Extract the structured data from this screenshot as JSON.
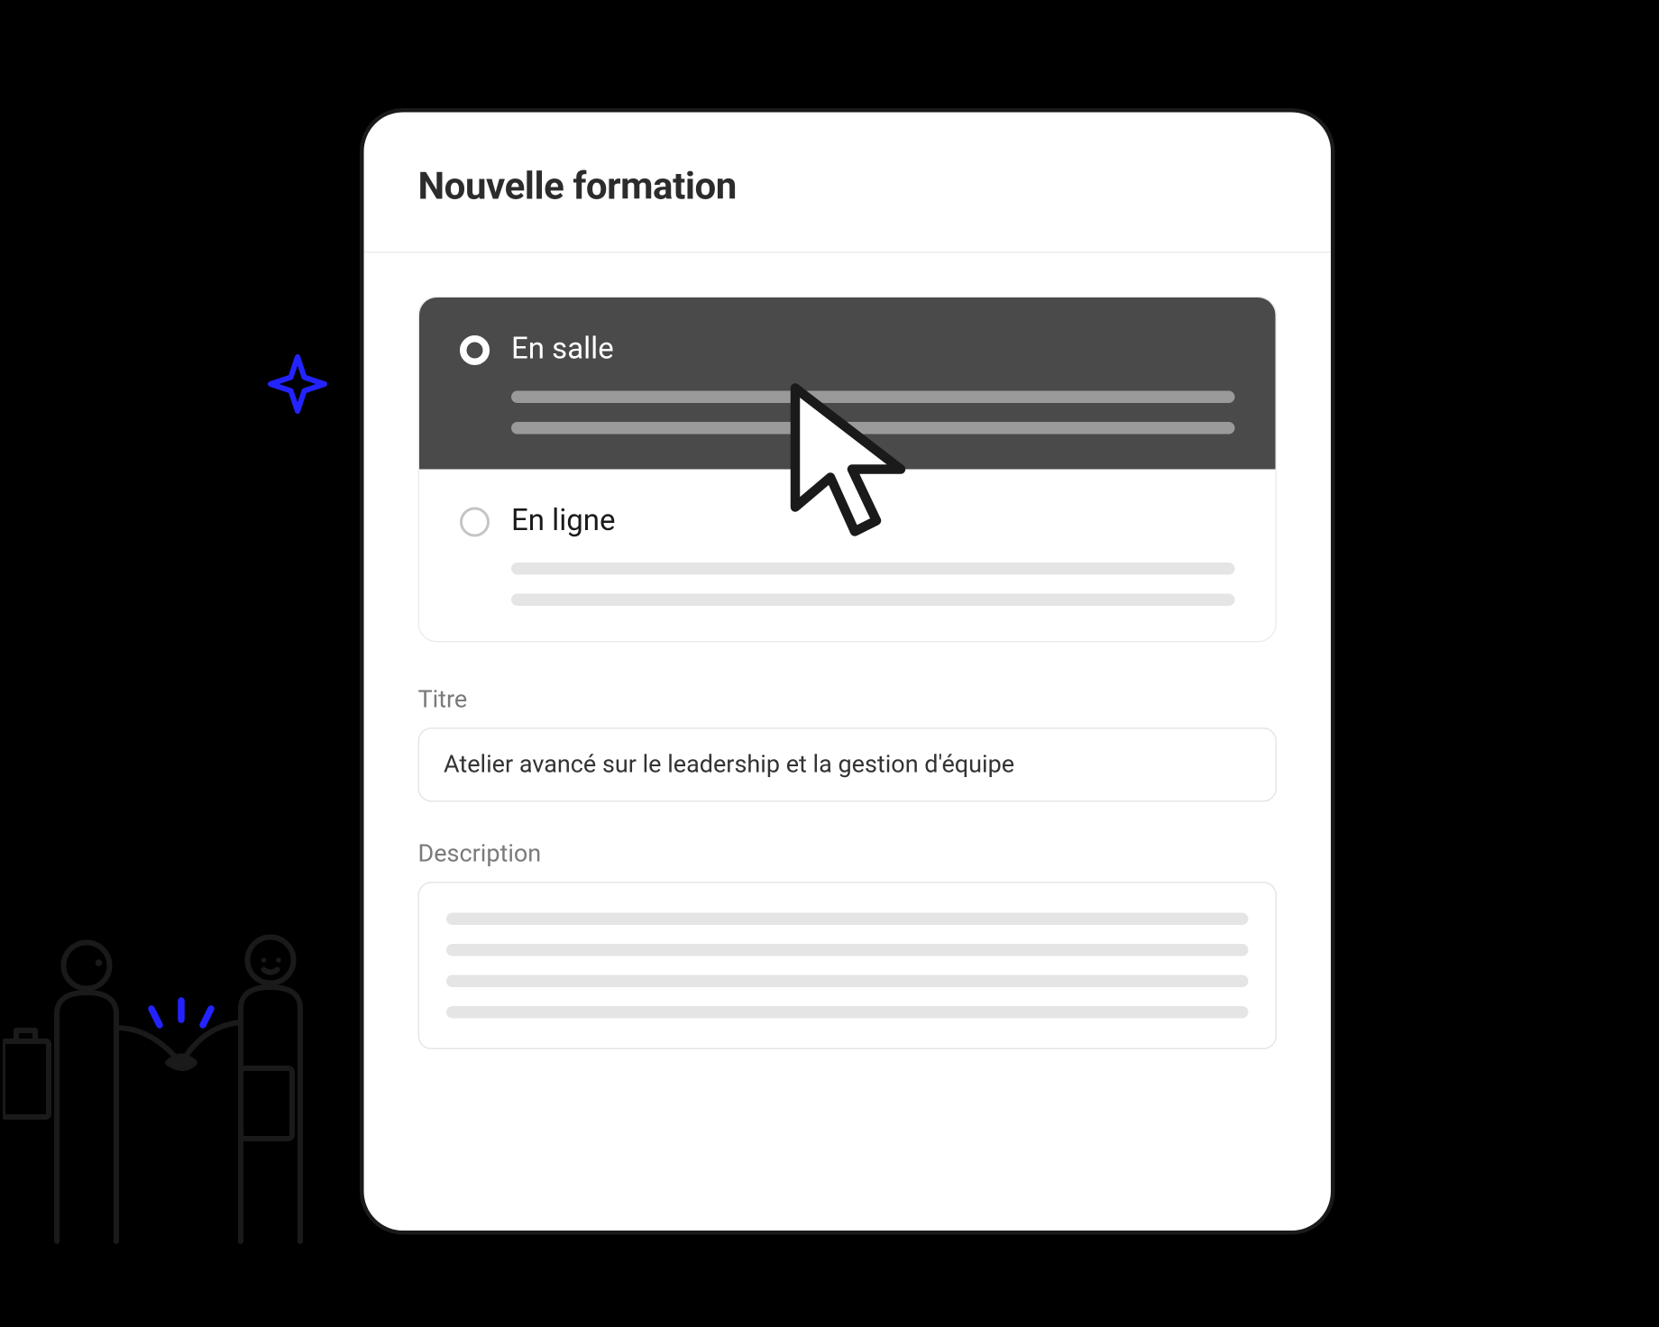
{
  "form": {
    "title": "Nouvelle formation",
    "type_options": [
      {
        "label": "En salle",
        "selected": true
      },
      {
        "label": "En ligne",
        "selected": false
      }
    ],
    "fields": {
      "title": {
        "label": "Titre",
        "value": "Atelier avancé sur le leadership et la gestion d'équipe"
      },
      "description": {
        "label": "Description"
      }
    }
  },
  "accent_color": "#2323ff"
}
